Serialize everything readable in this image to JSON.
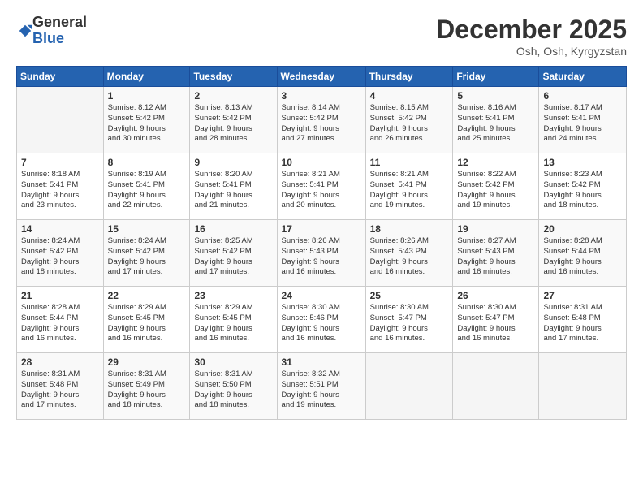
{
  "header": {
    "logo_line1": "General",
    "logo_line2": "Blue",
    "month": "December 2025",
    "location": "Osh, Osh, Kyrgyzstan"
  },
  "weekdays": [
    "Sunday",
    "Monday",
    "Tuesday",
    "Wednesday",
    "Thursday",
    "Friday",
    "Saturday"
  ],
  "weeks": [
    [
      {
        "day": "",
        "info": ""
      },
      {
        "day": "1",
        "info": "Sunrise: 8:12 AM\nSunset: 5:42 PM\nDaylight: 9 hours\nand 30 minutes."
      },
      {
        "day": "2",
        "info": "Sunrise: 8:13 AM\nSunset: 5:42 PM\nDaylight: 9 hours\nand 28 minutes."
      },
      {
        "day": "3",
        "info": "Sunrise: 8:14 AM\nSunset: 5:42 PM\nDaylight: 9 hours\nand 27 minutes."
      },
      {
        "day": "4",
        "info": "Sunrise: 8:15 AM\nSunset: 5:42 PM\nDaylight: 9 hours\nand 26 minutes."
      },
      {
        "day": "5",
        "info": "Sunrise: 8:16 AM\nSunset: 5:41 PM\nDaylight: 9 hours\nand 25 minutes."
      },
      {
        "day": "6",
        "info": "Sunrise: 8:17 AM\nSunset: 5:41 PM\nDaylight: 9 hours\nand 24 minutes."
      }
    ],
    [
      {
        "day": "7",
        "info": "Sunrise: 8:18 AM\nSunset: 5:41 PM\nDaylight: 9 hours\nand 23 minutes."
      },
      {
        "day": "8",
        "info": "Sunrise: 8:19 AM\nSunset: 5:41 PM\nDaylight: 9 hours\nand 22 minutes."
      },
      {
        "day": "9",
        "info": "Sunrise: 8:20 AM\nSunset: 5:41 PM\nDaylight: 9 hours\nand 21 minutes."
      },
      {
        "day": "10",
        "info": "Sunrise: 8:21 AM\nSunset: 5:41 PM\nDaylight: 9 hours\nand 20 minutes."
      },
      {
        "day": "11",
        "info": "Sunrise: 8:21 AM\nSunset: 5:41 PM\nDaylight: 9 hours\nand 19 minutes."
      },
      {
        "day": "12",
        "info": "Sunrise: 8:22 AM\nSunset: 5:42 PM\nDaylight: 9 hours\nand 19 minutes."
      },
      {
        "day": "13",
        "info": "Sunrise: 8:23 AM\nSunset: 5:42 PM\nDaylight: 9 hours\nand 18 minutes."
      }
    ],
    [
      {
        "day": "14",
        "info": "Sunrise: 8:24 AM\nSunset: 5:42 PM\nDaylight: 9 hours\nand 18 minutes."
      },
      {
        "day": "15",
        "info": "Sunrise: 8:24 AM\nSunset: 5:42 PM\nDaylight: 9 hours\nand 17 minutes."
      },
      {
        "day": "16",
        "info": "Sunrise: 8:25 AM\nSunset: 5:42 PM\nDaylight: 9 hours\nand 17 minutes."
      },
      {
        "day": "17",
        "info": "Sunrise: 8:26 AM\nSunset: 5:43 PM\nDaylight: 9 hours\nand 16 minutes."
      },
      {
        "day": "18",
        "info": "Sunrise: 8:26 AM\nSunset: 5:43 PM\nDaylight: 9 hours\nand 16 minutes."
      },
      {
        "day": "19",
        "info": "Sunrise: 8:27 AM\nSunset: 5:43 PM\nDaylight: 9 hours\nand 16 minutes."
      },
      {
        "day": "20",
        "info": "Sunrise: 8:28 AM\nSunset: 5:44 PM\nDaylight: 9 hours\nand 16 minutes."
      }
    ],
    [
      {
        "day": "21",
        "info": "Sunrise: 8:28 AM\nSunset: 5:44 PM\nDaylight: 9 hours\nand 16 minutes."
      },
      {
        "day": "22",
        "info": "Sunrise: 8:29 AM\nSunset: 5:45 PM\nDaylight: 9 hours\nand 16 minutes."
      },
      {
        "day": "23",
        "info": "Sunrise: 8:29 AM\nSunset: 5:45 PM\nDaylight: 9 hours\nand 16 minutes."
      },
      {
        "day": "24",
        "info": "Sunrise: 8:30 AM\nSunset: 5:46 PM\nDaylight: 9 hours\nand 16 minutes."
      },
      {
        "day": "25",
        "info": "Sunrise: 8:30 AM\nSunset: 5:47 PM\nDaylight: 9 hours\nand 16 minutes."
      },
      {
        "day": "26",
        "info": "Sunrise: 8:30 AM\nSunset: 5:47 PM\nDaylight: 9 hours\nand 16 minutes."
      },
      {
        "day": "27",
        "info": "Sunrise: 8:31 AM\nSunset: 5:48 PM\nDaylight: 9 hours\nand 17 minutes."
      }
    ],
    [
      {
        "day": "28",
        "info": "Sunrise: 8:31 AM\nSunset: 5:48 PM\nDaylight: 9 hours\nand 17 minutes."
      },
      {
        "day": "29",
        "info": "Sunrise: 8:31 AM\nSunset: 5:49 PM\nDaylight: 9 hours\nand 18 minutes."
      },
      {
        "day": "30",
        "info": "Sunrise: 8:31 AM\nSunset: 5:50 PM\nDaylight: 9 hours\nand 18 minutes."
      },
      {
        "day": "31",
        "info": "Sunrise: 8:32 AM\nSunset: 5:51 PM\nDaylight: 9 hours\nand 19 minutes."
      },
      {
        "day": "",
        "info": ""
      },
      {
        "day": "",
        "info": ""
      },
      {
        "day": "",
        "info": ""
      }
    ]
  ]
}
